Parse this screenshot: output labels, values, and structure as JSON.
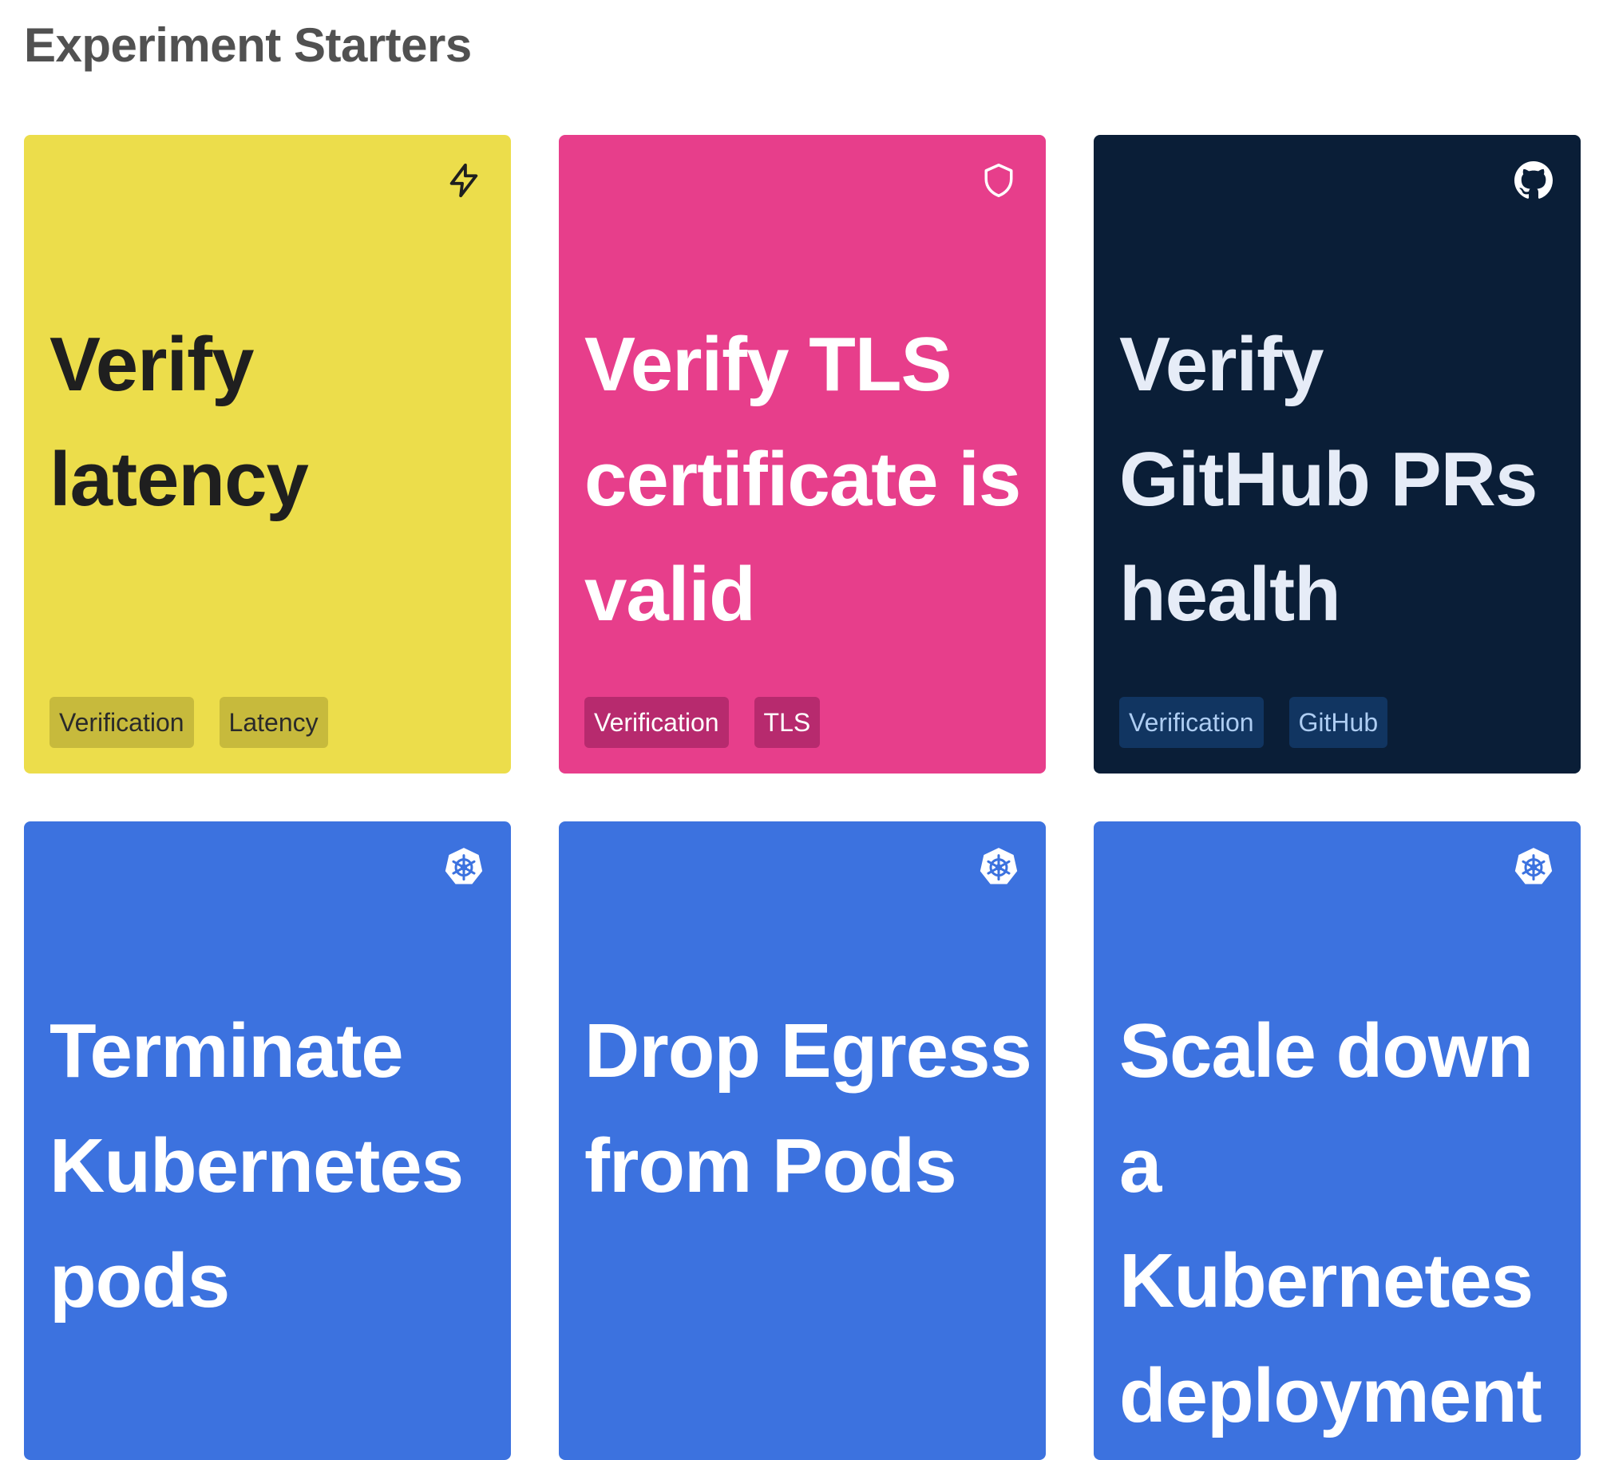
{
  "page": {
    "title": "Experiment Starters"
  },
  "cards": [
    {
      "title": "Verify latency",
      "icon": "lightning-icon",
      "theme_color": "#ecdd4b",
      "tags": [
        "Verification",
        "Latency"
      ]
    },
    {
      "title": "Verify TLS certificate is valid",
      "icon": "shield-icon",
      "theme_color": "#e73e8b",
      "tags": [
        "Verification",
        "TLS"
      ]
    },
    {
      "title": "Verify GitHub PRs health",
      "icon": "github-icon",
      "theme_color": "#0a1e37",
      "tags": [
        "Verification",
        "GitHub"
      ]
    },
    {
      "title": "Terminate Kubernetes pods",
      "icon": "kubernetes-icon",
      "theme_color": "#3c72df",
      "tags": []
    },
    {
      "title": "Drop Egress from Pods",
      "icon": "kubernetes-icon",
      "theme_color": "#3c72df",
      "tags": []
    },
    {
      "title": "Scale down a Kubernetes deployment",
      "icon": "kubernetes-icon",
      "theme_color": "#3c72df",
      "tags": []
    }
  ]
}
